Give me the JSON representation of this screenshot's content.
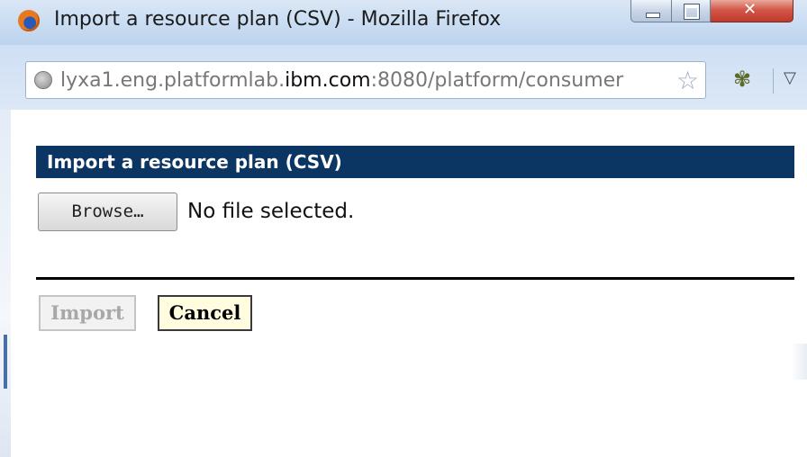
{
  "window": {
    "title": "Import a resource plan (CSV) - Mozilla Firefox",
    "icon": "firefox-icon"
  },
  "address_bar": {
    "url_prefix": "lyxa1.eng.platformlab.",
    "url_host": "ibm.com",
    "url_suffix": ":8080/platform/consumer",
    "icons": [
      "globe-icon",
      "star-icon",
      "bug-icon",
      "dropdown-icon"
    ]
  },
  "dialog": {
    "header": "Import a resource plan (CSV)",
    "browse_label": "Browse…",
    "file_status": "No file selected.",
    "import_label": "Import",
    "cancel_label": "Cancel"
  },
  "colors": {
    "header_bg": "#0b3563",
    "cancel_bg": "#fffce0",
    "disabled_text": "#a8a8a8"
  }
}
